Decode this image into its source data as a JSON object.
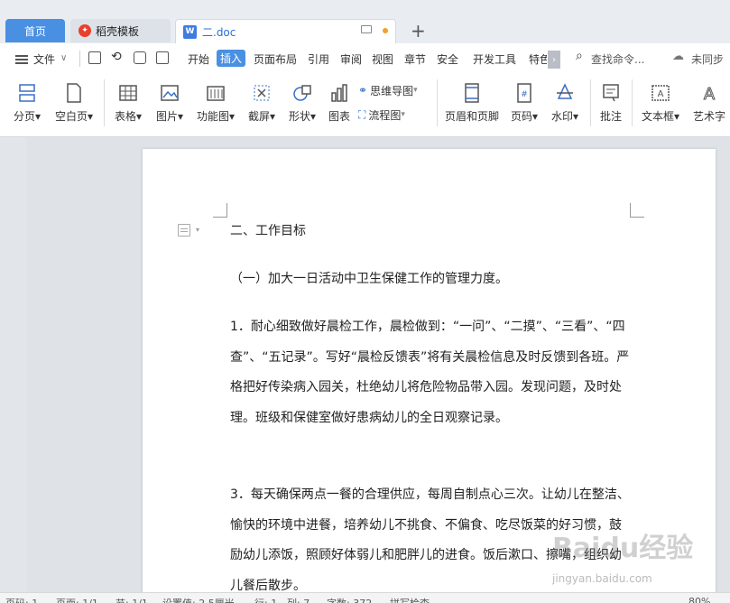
{
  "tabs": {
    "home": "首页",
    "templates": "稻壳模板",
    "document": "二.doc",
    "plus": "+"
  },
  "menu": {
    "file": "文件",
    "items": [
      "开始",
      "插入",
      "页面布局",
      "引用",
      "审阅",
      "视图",
      "章节",
      "安全",
      "开发工具",
      "特色"
    ],
    "active": "插入",
    "search": "查找命令...",
    "sync": "未同步",
    "more": "›"
  },
  "ribbon": {
    "page_break": "分页",
    "blank_page": "空白页",
    "table": "表格",
    "picture": "图片",
    "function_chart": "功能图",
    "screenshot": "截屏",
    "shape": "形状",
    "chart": "图表",
    "mindmap": "思维导图",
    "flowchart": "流程图",
    "header_footer": "页眉和页脚",
    "page_number": "页码",
    "watermark": "水印",
    "comment": "批注",
    "textbox": "文本框",
    "wordart": "艺术字"
  },
  "document": {
    "heading": "二、工作目标",
    "p1": "（一）加大一日活动中卫生保健工作的管理力度。",
    "p2": "1．耐心细致做好晨检工作，晨检做到：“一问”、“二摸”、“三看”、“四查”、“五记录”。写好“晨检反馈表”将有关晨检信息及时反馈到各班。严格把好传染病入园关，杜绝幼儿将危险物品带入园。发现问题，及时处理。班级和保健室做好患病幼儿的全日观察记录。",
    "p3": "3．每天确保两点一餐的合理供应，每周自制点心三次。让幼儿在整洁、愉快的环境中进餐，培养幼儿不挑食、不偏食、吃尽饭菜的好习惯，鼓励幼儿添饭，照顾好体弱儿和肥胖儿的进食。饭后漱口、擦嘴，组织幼儿餐后散步。"
  },
  "watermark": {
    "text": "Baidu经验",
    "url": "jingyan.baidu.com"
  },
  "statusbar": {
    "page": "页码: 1",
    "pages": "页面: 1/1",
    "section": "节: 1/1",
    "setting": "设置值: 2.5厘米",
    "row": "行: 1",
    "col": "列: 7",
    "words": "字数: 372",
    "spell": "拼写检查",
    "zoom": "80%"
  },
  "colors": {
    "accent": "#4a90e2",
    "tabbar": "#e9edf2",
    "workspace": "#dfe3e8"
  }
}
